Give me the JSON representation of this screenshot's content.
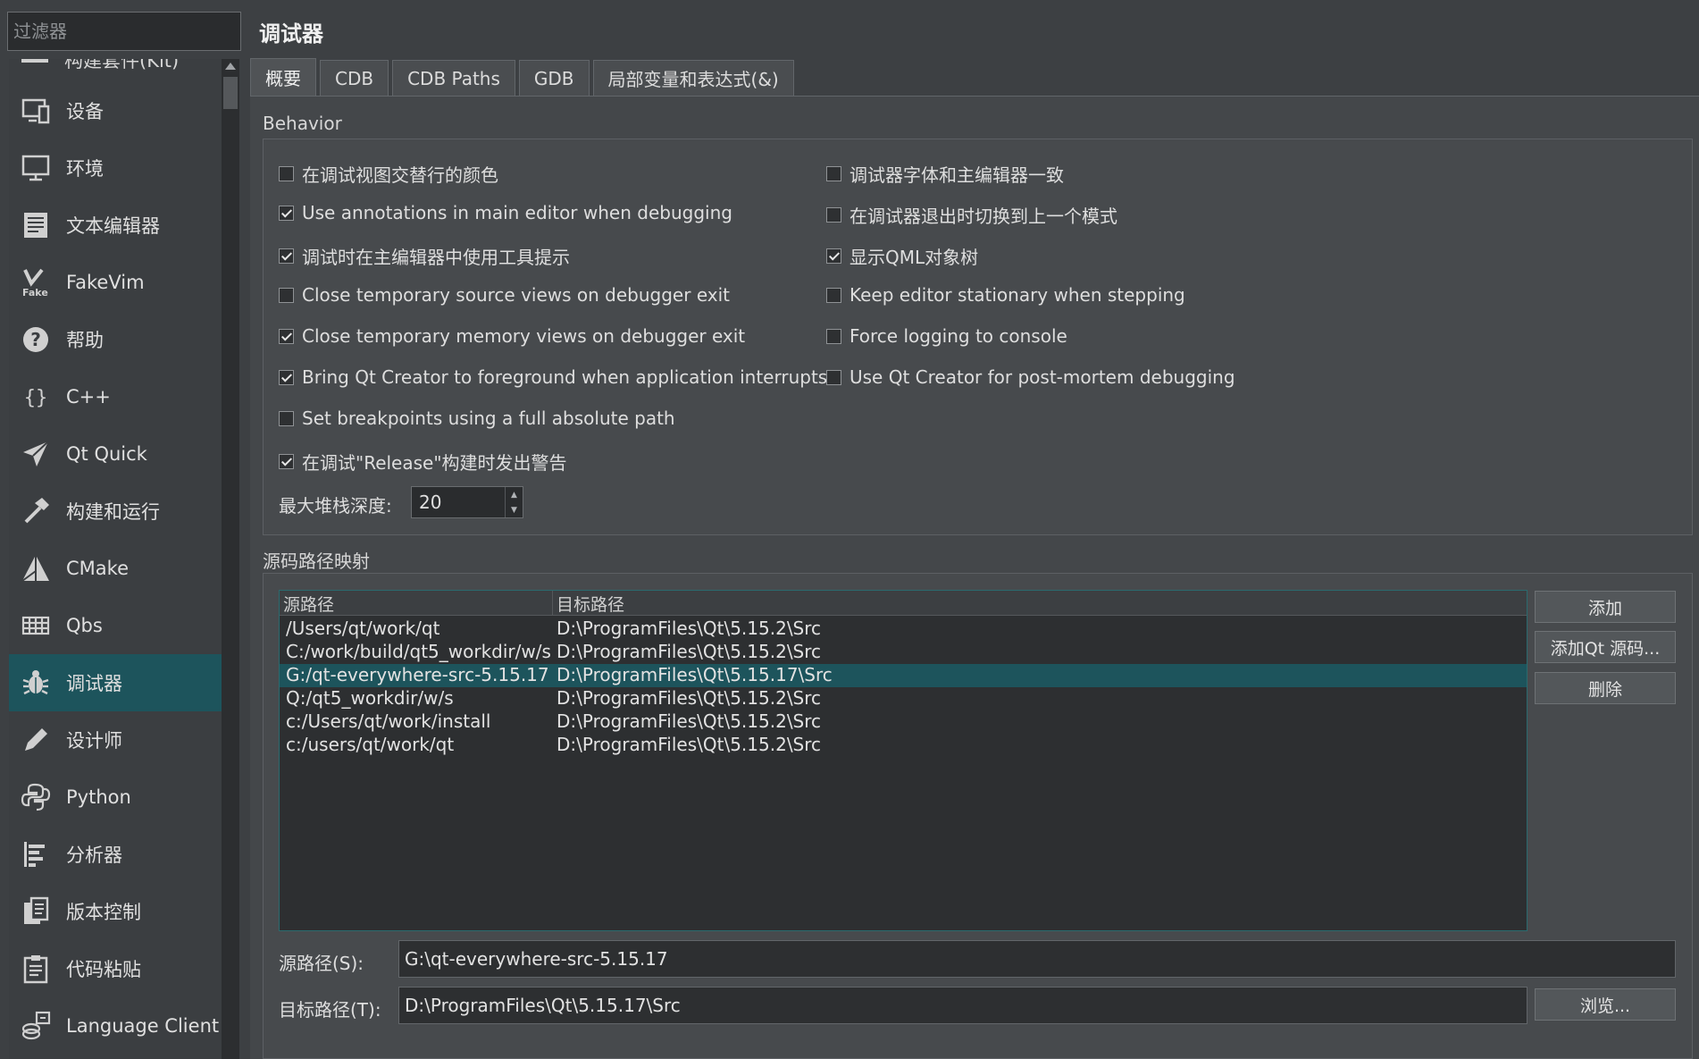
{
  "filter": {
    "placeholder": "过滤器"
  },
  "nav": {
    "cut_item_label": "构建套件(Kit)",
    "items": [
      {
        "label": "设备",
        "icon": "device-icon"
      },
      {
        "label": "环境",
        "icon": "monitor-icon"
      },
      {
        "label": "文本编辑器",
        "icon": "text-editor-icon"
      },
      {
        "label": "FakeVim",
        "icon": "fakevim-icon"
      },
      {
        "label": "帮助",
        "icon": "help-icon"
      },
      {
        "label": "C++",
        "icon": "braces-icon"
      },
      {
        "label": "Qt Quick",
        "icon": "paper-plane-icon"
      },
      {
        "label": "构建和运行",
        "icon": "hammer-icon"
      },
      {
        "label": "CMake",
        "icon": "cmake-icon"
      },
      {
        "label": "Qbs",
        "icon": "qbs-icon"
      },
      {
        "label": "调试器",
        "icon": "bug-icon",
        "active": true
      },
      {
        "label": "设计师",
        "icon": "pencil-icon"
      },
      {
        "label": "Python",
        "icon": "python-icon"
      },
      {
        "label": "分析器",
        "icon": "analyzer-icon"
      },
      {
        "label": "版本控制",
        "icon": "version-control-icon"
      },
      {
        "label": "代码粘贴",
        "icon": "clipboard-icon"
      },
      {
        "label": "Language Client",
        "icon": "language-client-icon"
      }
    ]
  },
  "page": {
    "title": "调试器"
  },
  "tabs": [
    "概要",
    "CDB",
    "CDB Paths",
    "GDB",
    "局部变量和表达式(&)"
  ],
  "behavior": {
    "title": "Behavior",
    "left": [
      {
        "label": "在调试视图交替行的颜色",
        "checked": false
      },
      {
        "label": "Use annotations in main editor when debugging",
        "checked": true
      },
      {
        "label": "调试时在主编辑器中使用工具提示",
        "checked": true
      },
      {
        "label": "Close temporary source views on debugger exit",
        "checked": false
      },
      {
        "label": "Close temporary memory views on debugger exit",
        "checked": true
      },
      {
        "label": "Bring Qt Creator to foreground when application interrupts",
        "checked": true
      },
      {
        "label": "Set breakpoints using a full absolute path",
        "checked": false
      },
      {
        "label": "在调试\"Release\"构建时发出警告",
        "checked": true
      }
    ],
    "right": [
      {
        "label": "调试器字体和主编辑器一致",
        "checked": false
      },
      {
        "label": "在调试器退出时切换到上一个模式",
        "checked": false
      },
      {
        "label": "显示QML对象树",
        "checked": true
      },
      {
        "label": "Keep editor stationary when stepping",
        "checked": false
      },
      {
        "label": "Force logging to console",
        "checked": false
      },
      {
        "label": "Use Qt Creator for post-mortem debugging",
        "checked": false
      }
    ],
    "stack_depth_label": "最大堆栈深度:",
    "stack_depth_value": "20"
  },
  "source_map": {
    "title": "源码路径映射",
    "columns": [
      "源路径",
      "目标路径"
    ],
    "rows": [
      {
        "source": "/Users/qt/work/qt",
        "target": "D:\\ProgramFiles\\Qt\\5.15.2\\Src"
      },
      {
        "source": "C:/work/build/qt5_workdir/w/s",
        "target": "D:\\ProgramFiles\\Qt\\5.15.2\\Src"
      },
      {
        "source": "G:/qt-everywhere-src-5.15.17",
        "target": "D:\\ProgramFiles\\Qt\\5.15.17\\Src",
        "selected": true
      },
      {
        "source": "Q:/qt5_workdir/w/s",
        "target": "D:\\ProgramFiles\\Qt\\5.15.2\\Src"
      },
      {
        "source": "c:/Users/qt/work/install",
        "target": "D:\\ProgramFiles\\Qt\\5.15.2\\Src"
      },
      {
        "source": "c:/users/qt/work/qt",
        "target": "D:\\ProgramFiles\\Qt\\5.15.2\\Src"
      }
    ],
    "buttons": {
      "add": "添加",
      "add_qt": "添加Qt 源码...",
      "remove": "删除",
      "browse": "浏览..."
    },
    "source_label": "源路径(S):",
    "source_value": "G:\\qt-everywhere-src-5.15.17",
    "target_label": "目标路径(T):",
    "target_value": "D:\\ProgramFiles\\Qt\\5.15.17\\Src"
  },
  "colors": {
    "accent": "#1d545c",
    "background": "#3d4043",
    "panel": "#44474a"
  }
}
